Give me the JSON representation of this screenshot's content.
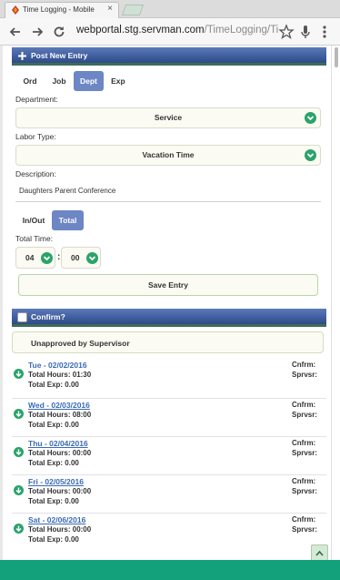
{
  "browser": {
    "tab_title": "Time Logging - Mobile",
    "tab_close": "×",
    "url_host": "webportal.stg.servman.com",
    "url_rest": "/TimeLogging/Time/In"
  },
  "post_entry": {
    "header": "Post New Entry",
    "tabs": [
      {
        "label": "Ord"
      },
      {
        "label": "Job"
      },
      {
        "label": "Dept"
      },
      {
        "label": "Exp"
      }
    ],
    "department_label": "Department:",
    "department_value": "Service",
    "labor_type_label": "Labor Type:",
    "labor_type_value": "Vacation Time",
    "description_label": "Description:",
    "description_value": "Daughters Parent Conference",
    "time_tabs": [
      {
        "label": "In/Out"
      },
      {
        "label": "Total"
      }
    ],
    "total_time_label": "Total Time:",
    "hours": "04",
    "colon": ":",
    "minutes": "00",
    "save_label": "Save Entry"
  },
  "confirm": {
    "header": "Confirm?",
    "status": "Unapproved by Supervisor"
  },
  "days": [
    {
      "date": "Tue - 02/02/2016",
      "hours": "Total Hours: 01:30",
      "exp": "Total Exp: 0.00",
      "cnfrm": "Cnfrm:",
      "sprvsr": "Sprvsr:"
    },
    {
      "date": "Wed - 02/03/2016",
      "hours": "Total Hours: 08:00",
      "exp": "Total Exp: 0.00",
      "cnfrm": "Cnfrm:",
      "sprvsr": "Sprvsr:"
    },
    {
      "date": "Thu - 02/04/2016",
      "hours": "Total Hours: 00:00",
      "exp": "Total Exp: 0.00",
      "cnfrm": "Cnfrm:",
      "sprvsr": "Sprvsr:"
    },
    {
      "date": "Fri - 02/05/2016",
      "hours": "Total Hours: 00:00",
      "exp": "Total Exp: 0.00",
      "cnfrm": "Cnfrm:",
      "sprvsr": "Sprvsr:"
    },
    {
      "date": "Sat - 02/06/2016",
      "hours": "Total Hours: 00:00",
      "exp": "Total Exp: 0.00",
      "cnfrm": "Cnfrm:",
      "sprvsr": "Sprvsr:"
    }
  ],
  "colors": {
    "accent": "#6d86c4",
    "panel_header": "#3f5d9e",
    "chevron": "#2aa36b",
    "footer": "#13a17b",
    "link": "#3a6bb2"
  },
  "icons": [
    "favicon-icon",
    "close-icon",
    "back-arrow-icon",
    "forward-arrow-icon",
    "reload-icon",
    "star-icon",
    "mic-icon",
    "menu-dots-icon",
    "plus-icon",
    "chevron-down-icon",
    "download-circle-icon",
    "chevron-up-icon"
  ]
}
